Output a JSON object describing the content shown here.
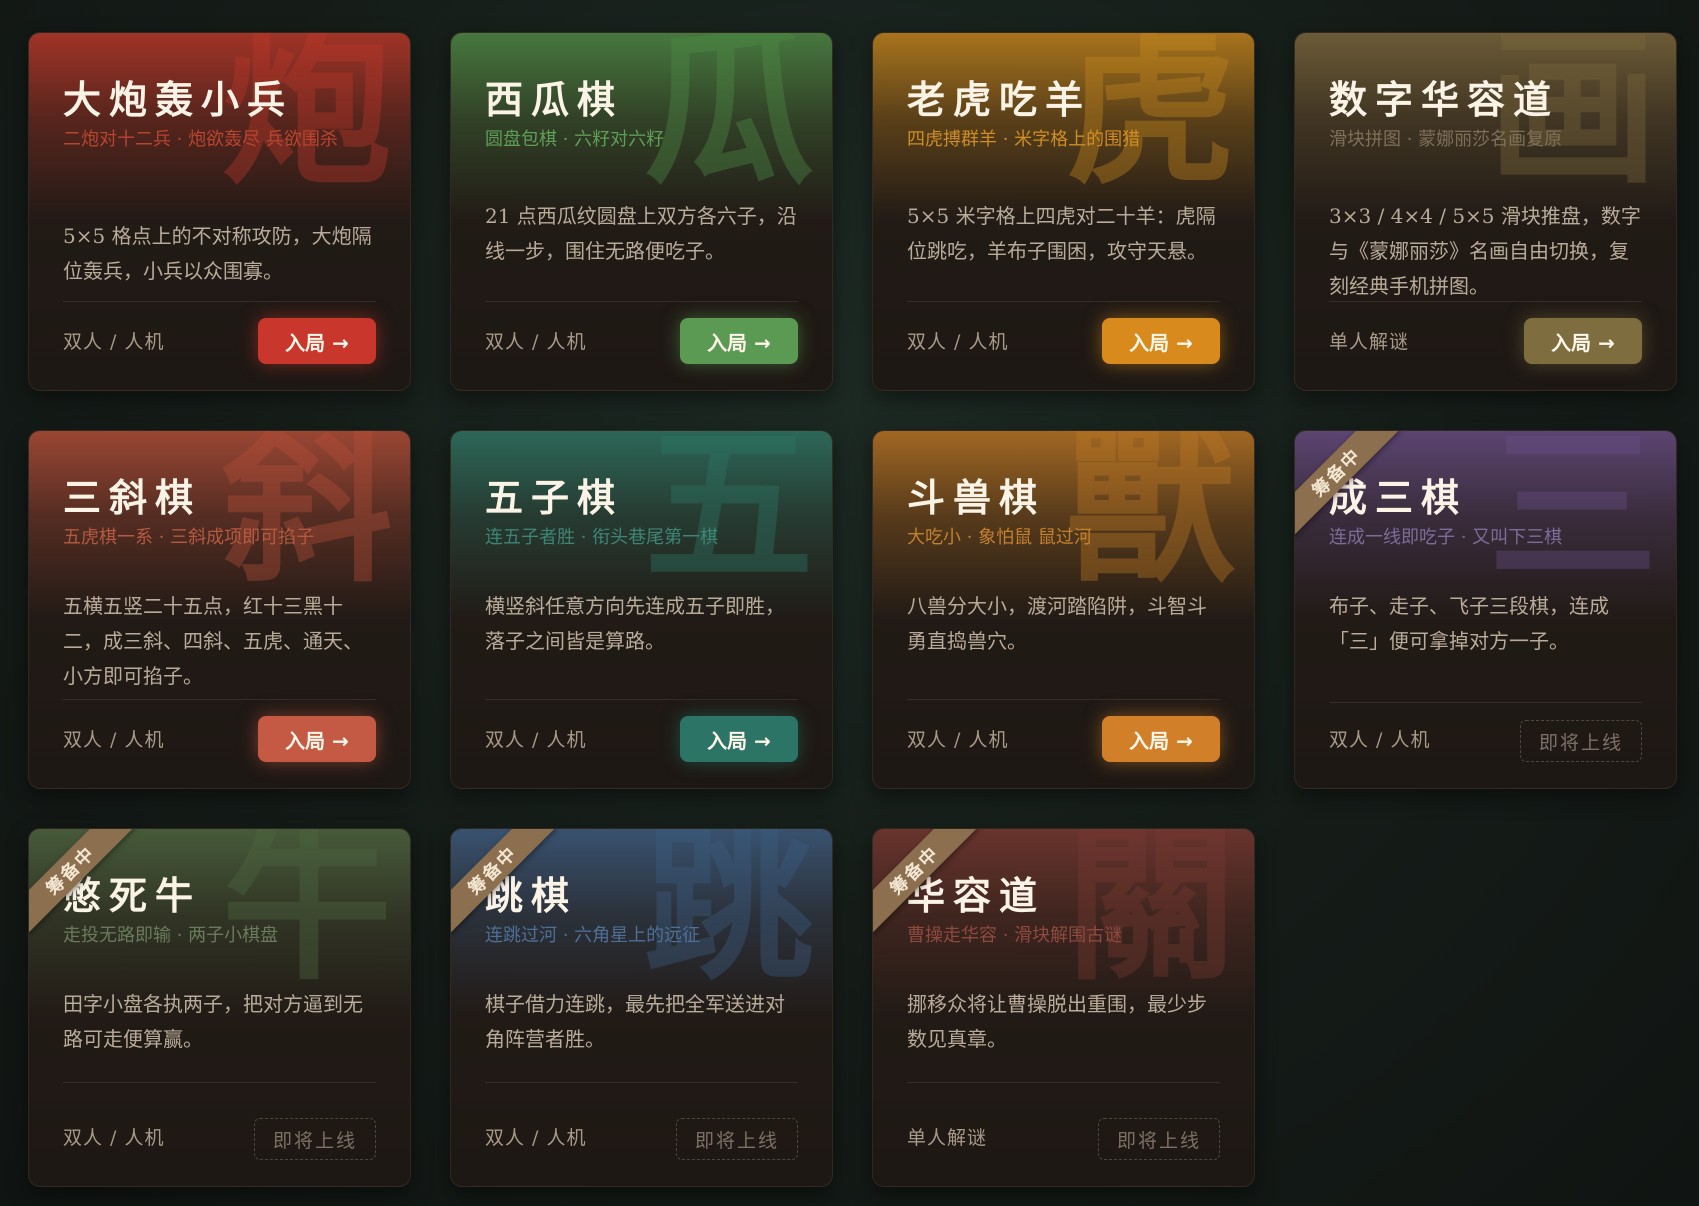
{
  "games": [
    {
      "char": "炮",
      "title": "大炮轰小兵",
      "subtitle": "二炮对十二兵 · 炮欲轰尽 兵欲围杀",
      "desc": "5×5 格点上的不对称攻防，大炮隔位轰兵，小兵以众围寡。",
      "mode": "双人 / 人机",
      "action": "入局 →",
      "status": "available",
      "accent": "#c0392b",
      "sub_color": "#b8452f",
      "btn_color": "#c9372c"
    },
    {
      "char": "瓜",
      "title": "西瓜棋",
      "subtitle": "圆盘包棋 · 六籽对六籽",
      "desc": "21 点西瓜纹圆盘上双方各六子，沿线一步，围住无路便吃子。",
      "mode": "双人 / 人机",
      "action": "入局 →",
      "status": "available",
      "accent": "#4f8f48",
      "sub_color": "#5f9e57",
      "btn_color": "#5a9a52"
    },
    {
      "char": "虎",
      "title": "老虎吃羊",
      "subtitle": "四虎搏群羊 · 米字格上的围猎",
      "desc": "5×5 米字格上四虎对二十羊：虎隔位跳吃，羊布子围困，攻守天悬。",
      "mode": "双人 / 人机",
      "action": "入局 →",
      "status": "available",
      "accent": "#c98a1e",
      "sub_color": "#cf8d23",
      "btn_color": "#d88a1c"
    },
    {
      "char": "画",
      "title": "数字华容道",
      "subtitle": "滑块拼图 · 蒙娜丽莎名画复原",
      "desc": "3×3 / 4×4 / 5×5 滑块推盘，数字与《蒙娜丽莎》名画自由切换，复刻经典手机拼图。",
      "mode": "单人解谜",
      "action": "入局 →",
      "status": "available",
      "accent": "#7d6a3e",
      "sub_color": "#7f7058",
      "btn_color": "#7e6d3e"
    },
    {
      "char": "斜",
      "title": "三斜棋",
      "subtitle": "五虎棋一系 · 三斜成项即可掐子",
      "desc": "五横五竖二十五点，红十三黑十二，成三斜、四斜、五虎、通天、小方即可掐子。",
      "mode": "双人 / 人机",
      "action": "入局 →",
      "status": "available",
      "accent": "#b8503a",
      "sub_color": "#b45a40",
      "btn_color": "#c55a44"
    },
    {
      "char": "五",
      "title": "五子棋",
      "subtitle": "连五子者胜 · 衔头巷尾第一棋",
      "desc": "横竖斜任意方向先连成五子即胜，落子之间皆是算路。",
      "mode": "双人 / 人机",
      "action": "入局 →",
      "status": "available",
      "accent": "#2e7a68",
      "sub_color": "#3d8574",
      "btn_color": "#2c7466"
    },
    {
      "char": "獸",
      "title": "斗兽棋",
      "subtitle": "大吃小 · 象怕鼠 鼠过河",
      "desc": "八兽分大小，渡河踏陷阱，斗智斗勇直捣兽穴。",
      "mode": "双人 / 人机",
      "action": "入局 →",
      "status": "available",
      "accent": "#c07a25",
      "sub_color": "#c4802e",
      "btn_color": "#d27f2a"
    },
    {
      "char": "三",
      "title": "成三棋",
      "subtitle": "连成一线即吃子 · 又叫下三棋",
      "desc": "布子、走子、飞子三段棋，连成「三」便可拿掉对方一子。",
      "mode": "双人 / 人机",
      "action": "即将上线",
      "status": "soon",
      "ribbon": "筹备中",
      "accent": "#6a4f88",
      "sub_color": "#7d6c9a",
      "btn_color": ""
    },
    {
      "char": "牛",
      "title": "憋死牛",
      "subtitle": "走投无路即输 · 两子小棋盘",
      "desc": "田字小盘各执两子，把对方逼到无路可走便算赢。",
      "mode": "双人 / 人机",
      "action": "即将上线",
      "status": "soon",
      "ribbon": "筹备中",
      "accent": "#4f6a42",
      "sub_color": "#6a7a5e",
      "btn_color": ""
    },
    {
      "char": "跳",
      "title": "跳棋",
      "subtitle": "连跳过河 · 六角星上的远征",
      "desc": "棋子借力连跳，最先把全军送进对角阵营者胜。",
      "mode": "双人 / 人机",
      "action": "即将上线",
      "status": "soon",
      "ribbon": "筹备中",
      "accent": "#3d5f85",
      "sub_color": "#4e6f96",
      "btn_color": ""
    },
    {
      "char": "關",
      "title": "华容道",
      "subtitle": "曹操走华容 · 滑块解围古谜",
      "desc": "挪移众将让曹操脱出重围，最少步数见真章。",
      "mode": "单人解谜",
      "action": "即将上线",
      "status": "soon",
      "ribbon": "筹备中",
      "accent": "#7a3a32",
      "sub_color": "#8f4a3f",
      "btn_color": ""
    }
  ]
}
